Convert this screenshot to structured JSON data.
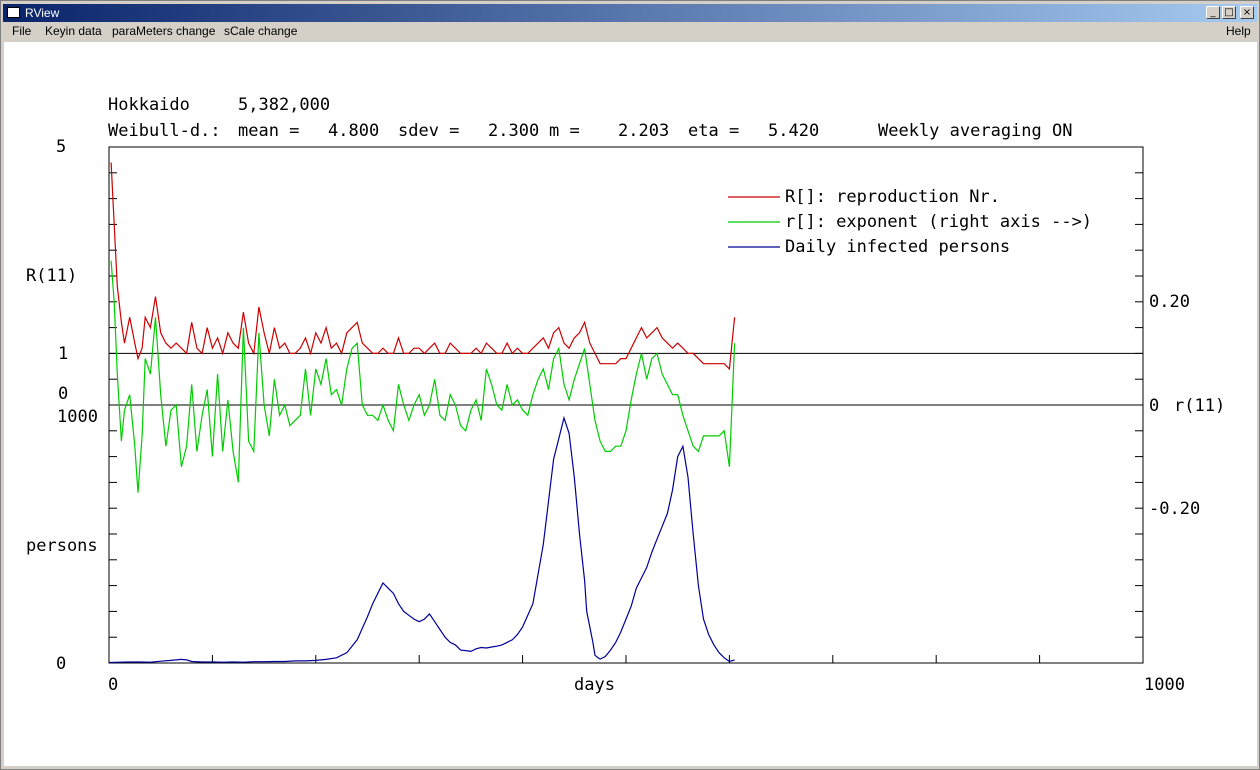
{
  "window": {
    "title": "RView",
    "controls": {
      "minimize": "_",
      "maximize": "□",
      "close": "×"
    }
  },
  "menu": {
    "file": "File",
    "keyin": "Keyin data",
    "parameters": "paraMeters change",
    "scale": "sCale change",
    "help": "Help"
  },
  "header": {
    "region": "Hokkaido",
    "population": "5,382,000",
    "weibull_label": "Weibull-d.:",
    "mean_label": "mean =",
    "mean_value": "4.800",
    "sdev_label": "sdev =",
    "sdev_value": "2.300",
    "m_label": "m =",
    "m_value": "2.203",
    "eta_label": "eta =",
    "eta_value": "5.420",
    "averaging": "Weekly averaging ON"
  },
  "colors": {
    "reproduction": "#cc0000",
    "exponent": "#00cc00",
    "infected": "#000099",
    "axis": "#000000"
  },
  "chart_data": {
    "type": "line",
    "x_label": "days",
    "x_range": [
      0,
      1000
    ],
    "x_tick_labels": [
      "0",
      "1000"
    ],
    "left_axis": {
      "R_label": "R(11)",
      "R_range": [
        0,
        5
      ],
      "R_tick_labels": [
        "5",
        "1",
        "0"
      ],
      "persons_label": "persons",
      "persons_range": [
        0,
        1000
      ],
      "persons_tick_labels": [
        "1000",
        "0"
      ]
    },
    "right_axis": {
      "label": "r(11)",
      "range": [
        -0.3,
        0.4
      ],
      "tick_labels": [
        "0.20",
        "0",
        "-0.20"
      ]
    },
    "reference_lines": [
      {
        "axis": "R",
        "value": 1
      },
      {
        "axis": "R",
        "value": 0
      }
    ],
    "legend": {
      "placement": "top-right",
      "entries": [
        "R[]: reproduction Nr.",
        "r[]: exponent (right axis -->)",
        "Daily infected persons"
      ]
    },
    "series": [
      {
        "name": "R[]: reproduction Nr.",
        "axis": "R",
        "x": [
          2,
          5,
          8,
          12,
          15,
          20,
          25,
          28,
          32,
          35,
          40,
          45,
          50,
          55,
          60,
          65,
          70,
          75,
          80,
          85,
          90,
          95,
          100,
          105,
          110,
          115,
          120,
          125,
          130,
          135,
          140,
          145,
          150,
          155,
          160,
          165,
          170,
          175,
          180,
          185,
          190,
          195,
          200,
          205,
          210,
          215,
          220,
          225,
          230,
          235,
          240,
          245,
          250,
          255,
          260,
          265,
          270,
          275,
          280,
          285,
          290,
          295,
          300,
          305,
          310,
          315,
          320,
          325,
          330,
          335,
          340,
          345,
          350,
          355,
          360,
          365,
          370,
          375,
          380,
          385,
          390,
          395,
          400,
          405,
          410,
          415,
          420,
          425,
          430,
          435,
          440,
          445,
          450,
          455,
          460,
          465,
          470,
          475,
          480,
          485,
          490,
          495,
          500,
          505,
          510,
          515,
          520,
          525,
          530,
          535,
          540,
          545,
          550,
          555,
          560,
          565,
          570,
          575,
          580,
          585,
          590,
          595,
          600,
          605
        ],
        "values": [
          4.7,
          3.5,
          2.3,
          1.6,
          1.2,
          1.7,
          1.2,
          0.9,
          1.1,
          1.7,
          1.5,
          2.1,
          1.4,
          1.2,
          1.1,
          1.2,
          1.1,
          1.0,
          1.6,
          1.1,
          1.0,
          1.5,
          1.1,
          1.3,
          1.0,
          1.4,
          1.2,
          1.1,
          1.8,
          1.2,
          1.0,
          1.9,
          1.4,
          1.0,
          1.5,
          1.1,
          1.2,
          1.0,
          1.0,
          1.1,
          1.3,
          1.0,
          1.4,
          1.2,
          1.5,
          1.1,
          1.2,
          1.0,
          1.4,
          1.5,
          1.6,
          1.2,
          1.1,
          1.0,
          1.0,
          1.1,
          1.0,
          1.0,
          1.3,
          1.0,
          1.0,
          1.1,
          1.1,
          1.0,
          1.1,
          1.2,
          1.0,
          1.0,
          1.2,
          1.1,
          1.0,
          1.0,
          1.0,
          1.1,
          1.0,
          1.2,
          1.1,
          1.0,
          1.0,
          1.2,
          1.0,
          1.1,
          1.0,
          1.0,
          1.1,
          1.2,
          1.3,
          1.1,
          1.4,
          1.5,
          1.2,
          1.1,
          1.3,
          1.4,
          1.6,
          1.2,
          1.0,
          0.8,
          0.8,
          0.8,
          0.8,
          0.9,
          0.9,
          1.1,
          1.3,
          1.5,
          1.3,
          1.4,
          1.5,
          1.3,
          1.2,
          1.1,
          1.2,
          1.1,
          1.0,
          1.0,
          0.9,
          0.8,
          0.8,
          0.8,
          0.8,
          0.8,
          0.7,
          1.7
        ]
      },
      {
        "name": "r[]: exponent (right axis -->)",
        "axis": "r",
        "x": [
          2,
          5,
          8,
          12,
          15,
          20,
          25,
          28,
          32,
          35,
          40,
          45,
          50,
          55,
          60,
          65,
          70,
          75,
          80,
          85,
          90,
          95,
          100,
          105,
          110,
          115,
          120,
          125,
          130,
          135,
          140,
          145,
          150,
          155,
          160,
          165,
          170,
          175,
          180,
          185,
          190,
          195,
          200,
          205,
          210,
          215,
          220,
          225,
          230,
          235,
          240,
          245,
          250,
          255,
          260,
          265,
          270,
          275,
          280,
          285,
          290,
          295,
          300,
          305,
          310,
          315,
          320,
          325,
          330,
          335,
          340,
          345,
          350,
          355,
          360,
          365,
          370,
          375,
          380,
          385,
          390,
          395,
          400,
          405,
          410,
          415,
          420,
          425,
          430,
          435,
          440,
          445,
          450,
          455,
          460,
          465,
          470,
          475,
          480,
          485,
          490,
          495,
          500,
          505,
          510,
          515,
          520,
          525,
          530,
          535,
          540,
          545,
          550,
          555,
          560,
          565,
          570,
          575,
          580,
          585,
          590,
          595,
          600,
          605
        ],
        "values": [
          0.28,
          0.2,
          0.06,
          -0.07,
          -0.01,
          0.02,
          -0.08,
          -0.17,
          -0.06,
          0.09,
          0.06,
          0.17,
          0.02,
          -0.08,
          -0.01,
          0.0,
          -0.12,
          -0.08,
          0.04,
          -0.09,
          -0.02,
          0.03,
          -0.1,
          0.06,
          -0.09,
          0.01,
          -0.09,
          -0.15,
          0.15,
          -0.07,
          -0.09,
          0.14,
          0.0,
          -0.06,
          0.05,
          -0.02,
          0.0,
          -0.04,
          -0.03,
          -0.02,
          0.07,
          -0.02,
          0.07,
          0.04,
          0.09,
          0.02,
          0.03,
          0.0,
          0.07,
          0.11,
          0.12,
          0.0,
          -0.02,
          -0.02,
          -0.03,
          0.0,
          -0.03,
          -0.05,
          0.04,
          0.0,
          -0.03,
          0.0,
          0.02,
          -0.02,
          0.0,
          0.05,
          -0.02,
          -0.03,
          0.02,
          0.0,
          -0.04,
          -0.05,
          -0.01,
          0.01,
          -0.03,
          0.07,
          0.04,
          0.0,
          -0.01,
          0.04,
          0.0,
          0.01,
          -0.01,
          -0.02,
          0.02,
          0.05,
          0.07,
          0.03,
          0.09,
          0.11,
          0.04,
          0.01,
          0.05,
          0.08,
          0.11,
          0.04,
          -0.03,
          -0.07,
          -0.09,
          -0.09,
          -0.08,
          -0.08,
          -0.05,
          0.01,
          0.06,
          0.1,
          0.05,
          0.09,
          0.1,
          0.06,
          0.04,
          0.02,
          0.02,
          -0.02,
          -0.05,
          -0.08,
          -0.09,
          -0.06,
          -0.06,
          -0.06,
          -0.06,
          -0.05,
          -0.12,
          0.12
        ]
      },
      {
        "name": "Daily infected persons",
        "axis": "persons",
        "x": [
          0,
          10,
          20,
          30,
          40,
          50,
          60,
          70,
          75,
          80,
          90,
          100,
          110,
          120,
          130,
          140,
          150,
          160,
          170,
          180,
          190,
          200,
          210,
          220,
          230,
          240,
          250,
          255,
          260,
          265,
          270,
          275,
          280,
          285,
          290,
          295,
          300,
          305,
          310,
          315,
          320,
          325,
          330,
          335,
          340,
          345,
          350,
          355,
          360,
          365,
          370,
          375,
          380,
          385,
          390,
          395,
          400,
          410,
          420,
          430,
          440,
          445,
          450,
          455,
          460,
          462,
          465,
          468,
          470,
          473,
          475,
          480,
          485,
          490,
          495,
          500,
          505,
          510,
          515,
          520,
          525,
          530,
          535,
          540,
          545,
          550,
          555,
          560,
          562,
          565,
          570,
          575,
          580,
          585,
          590,
          595,
          600,
          605
        ],
        "values": [
          2,
          3,
          4,
          4,
          3,
          7,
          10,
          14,
          12,
          6,
          4,
          4,
          3,
          4,
          3,
          5,
          5,
          6,
          6,
          8,
          8,
          10,
          14,
          20,
          40,
          90,
          180,
          230,
          270,
          310,
          290,
          270,
          230,
          200,
          185,
          170,
          160,
          170,
          190,
          160,
          130,
          100,
          80,
          70,
          50,
          48,
          45,
          55,
          60,
          58,
          62,
          65,
          70,
          80,
          90,
          110,
          140,
          230,
          460,
          790,
          950,
          890,
          720,
          500,
          320,
          200,
          140,
          80,
          30,
          20,
          15,
          25,
          50,
          80,
          120,
          170,
          220,
          290,
          330,
          370,
          430,
          480,
          530,
          580,
          670,
          800,
          840,
          720,
          630,
          500,
          300,
          170,
          110,
          70,
          40,
          20,
          6,
          12
        ]
      }
    ]
  }
}
